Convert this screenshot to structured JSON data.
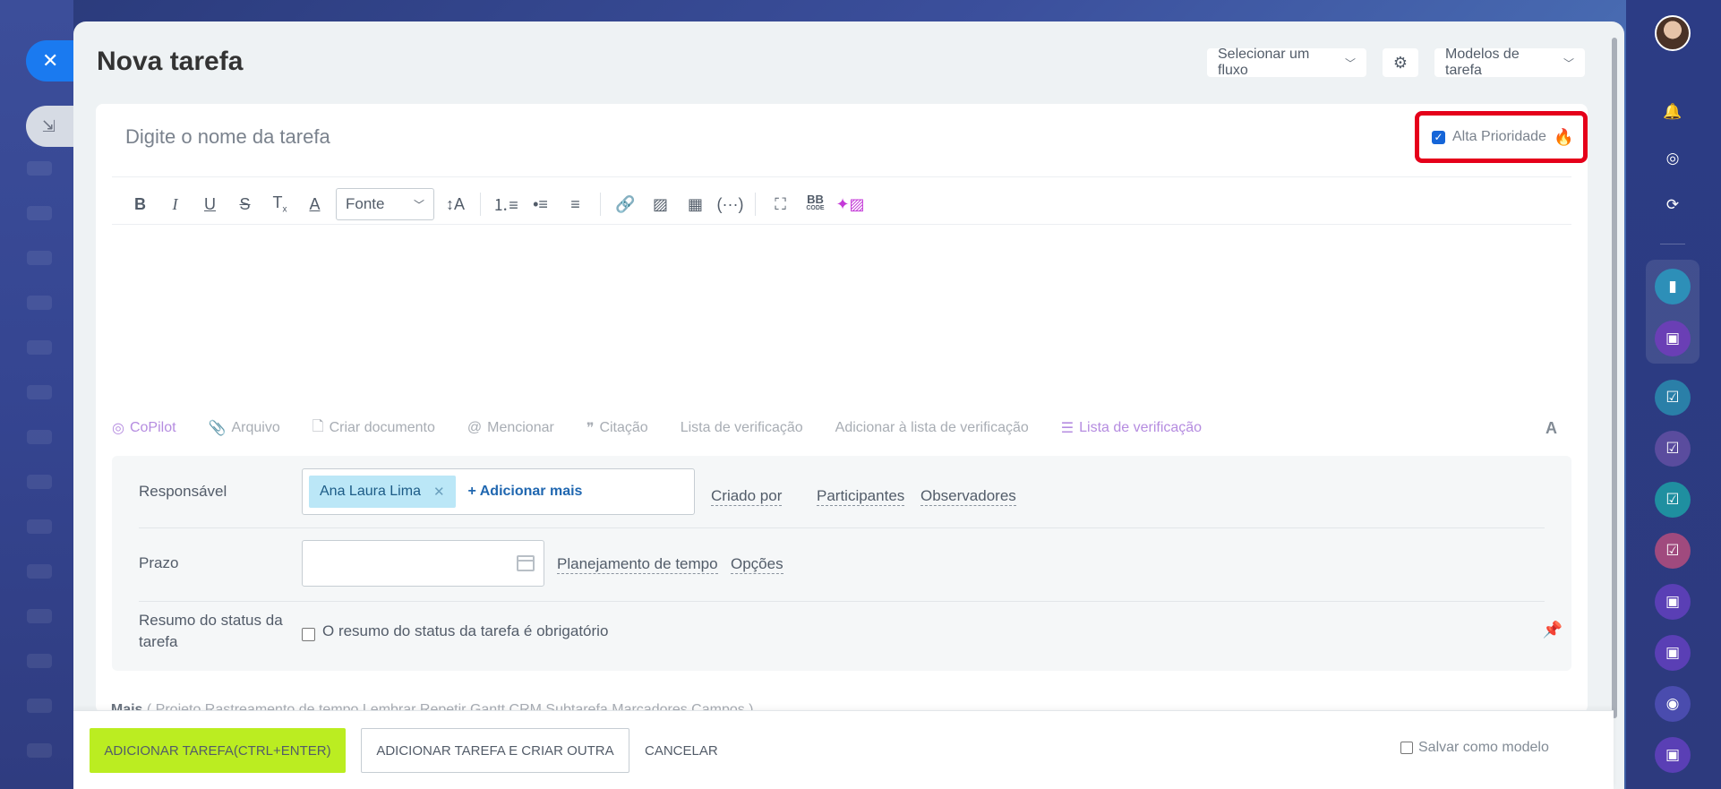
{
  "header": {
    "title": "Nova tarefa",
    "flow_select": "Selecionar um fluxo",
    "templates": "Modelos de tarefa"
  },
  "task": {
    "name_placeholder": "Digite o nome da tarefa",
    "priority_label": "Alta Prioridade",
    "priority_checked": true
  },
  "toolbar": {
    "font_label": "Fonte",
    "bbcode_top": "BB",
    "bbcode_bottom": "CODE"
  },
  "actions": {
    "copilot": "CoPilot",
    "file": "Arquivo",
    "create_doc": "Criar documento",
    "mention": "Mencionar",
    "quote": "Citação",
    "checklist": "Lista de verificação",
    "add_to_checklist": "Adicionar à lista de verificação",
    "checklist_new": "Lista de verificação",
    "format": "A"
  },
  "form": {
    "responsible_label": "Responsável",
    "responsible_person": "Ana Laura Lima",
    "add_more": "+ Adicionar mais",
    "created_by": "Criado por",
    "participants": "Participantes",
    "observers": "Observadores",
    "deadline_label": "Prazo",
    "time_planning": "Planejamento de tempo",
    "options": "Opções",
    "status_summary_label": "Resumo do status da tarefa",
    "status_summary_text": "O resumo do status da tarefa é obrigatório"
  },
  "more": {
    "label": "Mais",
    "items": "( Projeto   Rastreamento de tempo   Lembrar   Repetir   Gantt   CRM   Subtarefa   Marcadores   Campos )"
  },
  "footer": {
    "add_task": "ADICIONAR TAREFA(CTRL+ENTER)",
    "add_and_create": "ADICIONAR TAREFA E CRIAR OUTRA",
    "cancel": "CANCELAR",
    "save_template": "Salvar como modelo"
  },
  "colors": {
    "primary_button": "#bbed21",
    "highlight_border": "#e5001a",
    "close_button": "#1a7af0"
  }
}
